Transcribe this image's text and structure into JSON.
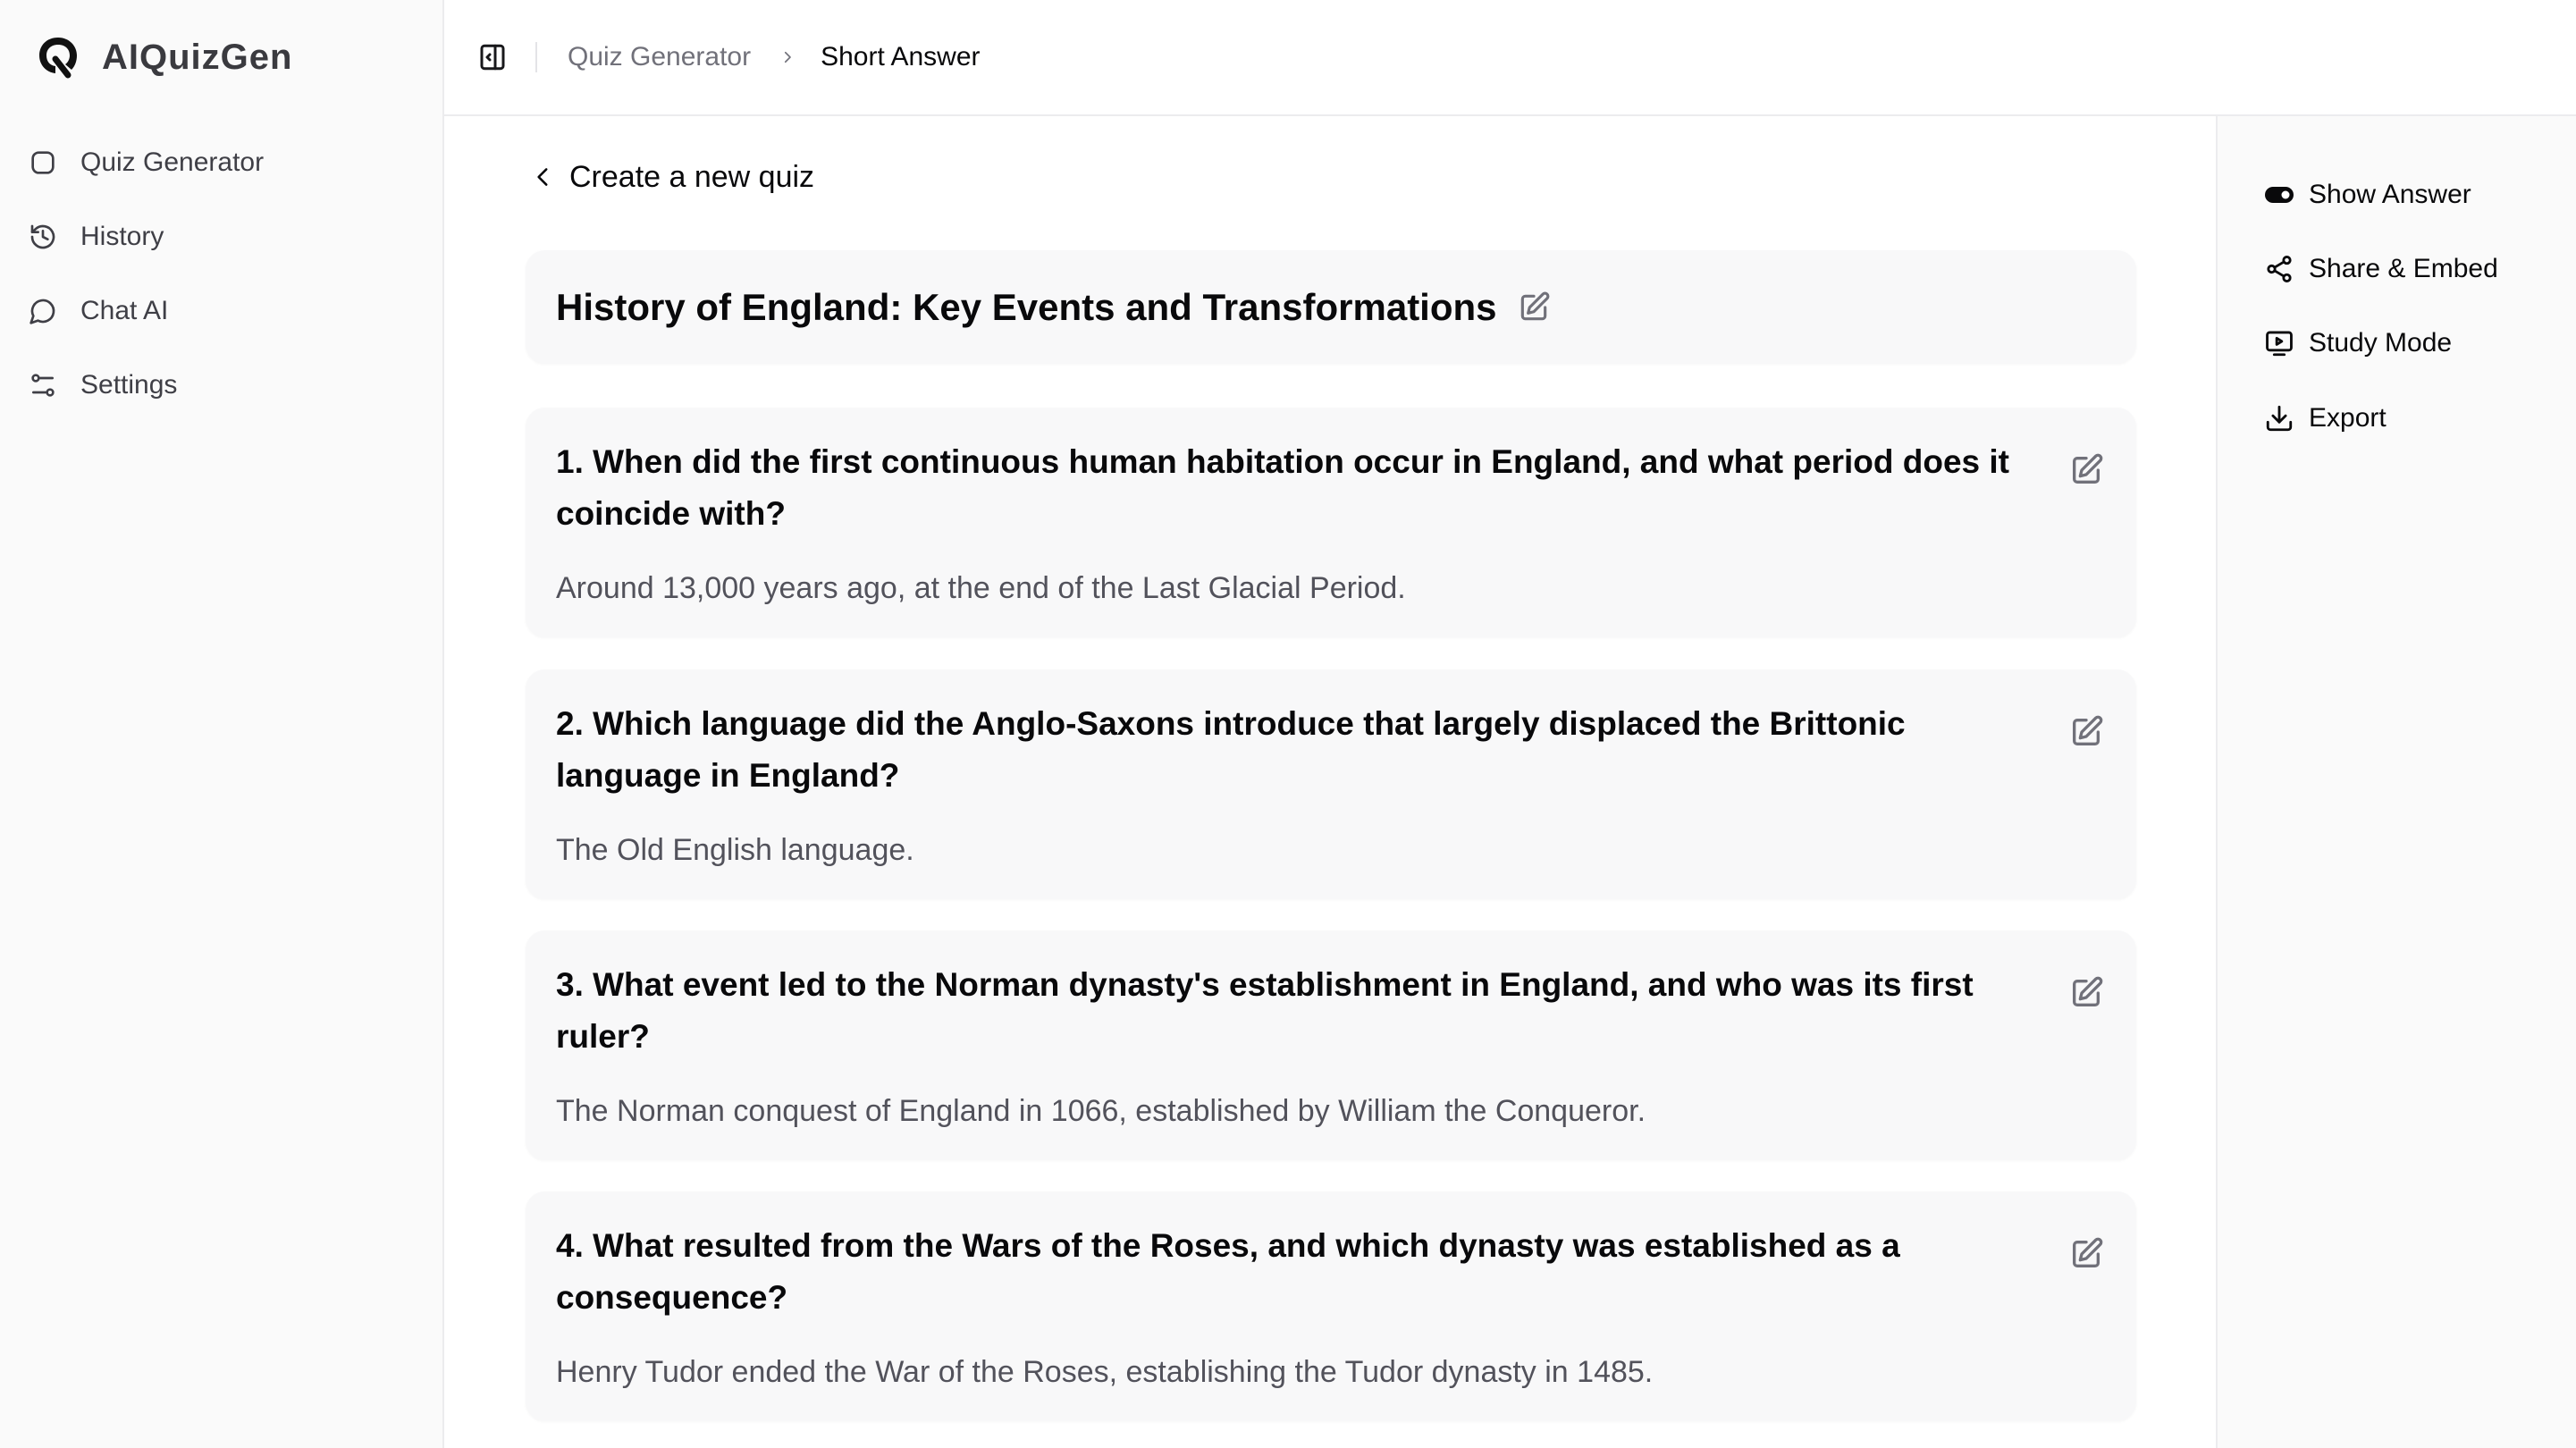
{
  "app": {
    "name": "AIQuizGen",
    "logo_icon": "q-logo-icon"
  },
  "sidebar": {
    "items": [
      {
        "label": "Quiz Generator",
        "icon": "square-icon"
      },
      {
        "label": "History",
        "icon": "history-icon"
      },
      {
        "label": "Chat AI",
        "icon": "chat-bubble-icon"
      },
      {
        "label": "Settings",
        "icon": "sliders-icon"
      }
    ]
  },
  "header": {
    "toggle_icon": "sidebar-collapse-icon",
    "breadcrumb": [
      {
        "label": "Quiz Generator"
      },
      {
        "label": "Short Answer"
      }
    ]
  },
  "main": {
    "back_label": "Create a new quiz",
    "quiz_title": "History of England: Key Events and Transformations",
    "questions": [
      {
        "question": "1. When did the first continuous human habitation occur in England, and what period does it coincide with?",
        "answer": "Around 13,000 years ago, at the end of the Last Glacial Period."
      },
      {
        "question": "2. Which language did the Anglo-Saxons introduce that largely displaced the Brittonic language in England?",
        "answer": "The Old English language."
      },
      {
        "question": "3. What event led to the Norman dynasty's establishment in England, and who was its first ruler?",
        "answer": "The Norman conquest of England in 1066, established by William the Conqueror."
      },
      {
        "question": "4. What resulted from the Wars of the Roses, and which dynasty was established as a consequence?",
        "answer": "Henry Tudor ended the War of the Roses, establishing the Tudor dynasty in 1485."
      }
    ]
  },
  "right_panel": {
    "actions": [
      {
        "label": "Show Answer",
        "icon": "toggle-on-icon",
        "state": "on"
      },
      {
        "label": "Share & Embed",
        "icon": "share-icon"
      },
      {
        "label": "Study Mode",
        "icon": "monitor-play-icon"
      },
      {
        "label": "Export",
        "icon": "download-icon"
      }
    ]
  },
  "colors": {
    "text_primary": "#09090b",
    "text_muted": "#71717a",
    "answer_text": "#52525b",
    "card_bg": "#f8f8f9",
    "panel_bg": "#fafafa",
    "border": "#ececee"
  }
}
